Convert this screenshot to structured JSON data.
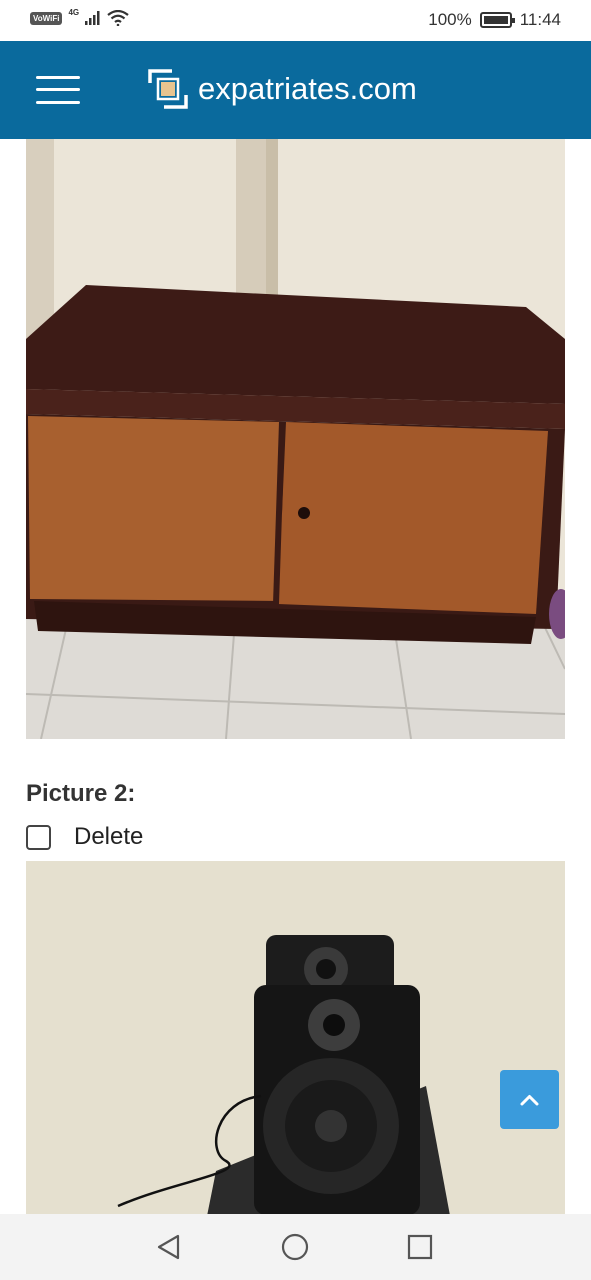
{
  "status_bar": {
    "vowifi": "VoWiFi",
    "network": "4G",
    "battery": "100%",
    "time": "11:44"
  },
  "header": {
    "brand": "expatriates.com",
    "menu_icon": "hamburger-menu-icon",
    "logo_icon": "expatriates-logo-icon",
    "background_color": "#0a6a9d"
  },
  "picture2": {
    "label": "Picture 2:",
    "delete_label": "Delete",
    "delete_checked": false
  },
  "scroll_top": {
    "icon": "chevron-up-icon",
    "color": "#3a9bdc"
  },
  "nav_bar": {
    "icons": [
      "back-triangle-icon",
      "home-circle-icon",
      "recents-square-icon"
    ]
  }
}
